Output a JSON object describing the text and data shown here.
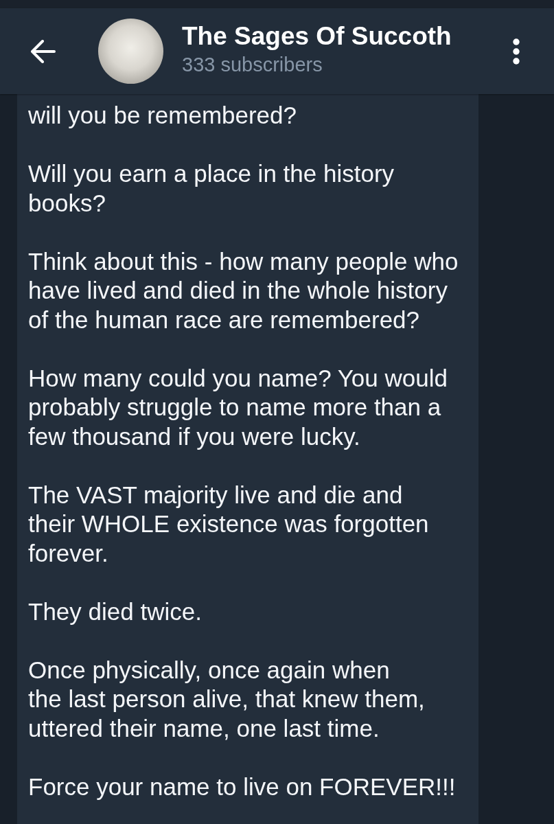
{
  "header": {
    "title": "The Sages Of Succoth",
    "subtitle": "333 subscribers"
  },
  "message": {
    "paragraphs": [
      {
        "lines": [
          "will you be remembered?"
        ]
      },
      {
        "lines": [
          "Will you earn a place in the history",
          "books?"
        ]
      },
      {
        "lines": [
          "Think about this - how many people who",
          "have lived and died in the whole history",
          "of the human race are remembered?"
        ]
      },
      {
        "lines": [
          "How many could you name? You would",
          "probably struggle to name more than a",
          "few thousand if you were lucky."
        ]
      },
      {
        "lines": [
          "The VAST majority live and die and",
          "their WHOLE existence was forgotten",
          "forever."
        ]
      },
      {
        "lines": [
          "They died twice."
        ]
      },
      {
        "lines": [
          "Once physically, once again when",
          "the last person alive, that knew them,",
          "uttered their name, one last time."
        ]
      },
      {
        "lines": [
          "Force your name to live on FOREVER!!!"
        ]
      }
    ]
  }
}
